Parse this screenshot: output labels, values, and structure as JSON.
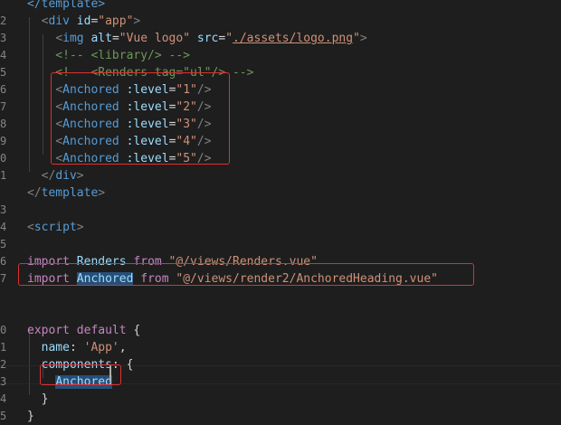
{
  "editor": {
    "gutter": [
      "",
      "2",
      "3",
      "4",
      "5",
      "6",
      "7",
      "8",
      "9",
      "0",
      "1",
      "",
      "3",
      "4",
      "5",
      "6",
      "7",
      "",
      "",
      "0",
      "1",
      "2",
      "3",
      "4",
      "5"
    ],
    "lines": [
      [
        {
          "t": "</template>",
          "c": "tk-tag"
        }
      ],
      [
        {
          "t": "  ",
          "c": "tk-plain"
        },
        {
          "t": "<",
          "c": "tk-bracket"
        },
        {
          "t": "div",
          "c": "tk-tag"
        },
        {
          "t": " id",
          "c": "tk-attr"
        },
        {
          "t": "=",
          "c": "tk-plain"
        },
        {
          "t": "\"app\"",
          "c": "tk-str"
        },
        {
          "t": ">",
          "c": "tk-bracket"
        }
      ],
      [
        {
          "t": "    ",
          "c": "tk-plain"
        },
        {
          "t": "<",
          "c": "tk-bracket"
        },
        {
          "t": "img",
          "c": "tk-tag"
        },
        {
          "t": " alt",
          "c": "tk-attr"
        },
        {
          "t": "=",
          "c": "tk-plain"
        },
        {
          "t": "\"Vue logo\"",
          "c": "tk-str"
        },
        {
          "t": " src",
          "c": "tk-attr"
        },
        {
          "t": "=",
          "c": "tk-plain"
        },
        {
          "t": "\"",
          "c": "tk-str"
        },
        {
          "t": "./assets/logo.png",
          "c": "tk-str tk-link"
        },
        {
          "t": "\"",
          "c": "tk-str"
        },
        {
          "t": ">",
          "c": "tk-bracket"
        }
      ],
      [
        {
          "t": "    <!-- <library/> -->",
          "c": "tk-comment"
        }
      ],
      [
        {
          "t": "    <!-- <Renders tag=\"ul\"/> -->",
          "c": "tk-comment"
        }
      ],
      [
        {
          "t": "    ",
          "c": "tk-plain"
        },
        {
          "t": "<",
          "c": "tk-bracket"
        },
        {
          "t": "Anchored",
          "c": "tk-tag"
        },
        {
          "t": " :level",
          "c": "tk-attr"
        },
        {
          "t": "=",
          "c": "tk-plain"
        },
        {
          "t": "\"1\"",
          "c": "tk-str"
        },
        {
          "t": "/>",
          "c": "tk-bracket"
        }
      ],
      [
        {
          "t": "    ",
          "c": "tk-plain"
        },
        {
          "t": "<",
          "c": "tk-bracket"
        },
        {
          "t": "Anchored",
          "c": "tk-tag"
        },
        {
          "t": " :level",
          "c": "tk-attr"
        },
        {
          "t": "=",
          "c": "tk-plain"
        },
        {
          "t": "\"2\"",
          "c": "tk-str"
        },
        {
          "t": "/>",
          "c": "tk-bracket"
        }
      ],
      [
        {
          "t": "    ",
          "c": "tk-plain"
        },
        {
          "t": "<",
          "c": "tk-bracket"
        },
        {
          "t": "Anchored",
          "c": "tk-tag"
        },
        {
          "t": " :level",
          "c": "tk-attr"
        },
        {
          "t": "=",
          "c": "tk-plain"
        },
        {
          "t": "\"3\"",
          "c": "tk-str"
        },
        {
          "t": "/>",
          "c": "tk-bracket"
        }
      ],
      [
        {
          "t": "    ",
          "c": "tk-plain"
        },
        {
          "t": "<",
          "c": "tk-bracket"
        },
        {
          "t": "Anchored",
          "c": "tk-tag"
        },
        {
          "t": " :level",
          "c": "tk-attr"
        },
        {
          "t": "=",
          "c": "tk-plain"
        },
        {
          "t": "\"4\"",
          "c": "tk-str"
        },
        {
          "t": "/>",
          "c": "tk-bracket"
        }
      ],
      [
        {
          "t": "    ",
          "c": "tk-plain"
        },
        {
          "t": "<",
          "c": "tk-bracket"
        },
        {
          "t": "Anchored",
          "c": "tk-tag"
        },
        {
          "t": " :level",
          "c": "tk-attr"
        },
        {
          "t": "=",
          "c": "tk-plain"
        },
        {
          "t": "\"5\"",
          "c": "tk-str"
        },
        {
          "t": "/>",
          "c": "tk-bracket"
        }
      ],
      [
        {
          "t": "  ",
          "c": "tk-plain"
        },
        {
          "t": "</",
          "c": "tk-bracket"
        },
        {
          "t": "div",
          "c": "tk-tag"
        },
        {
          "t": ">",
          "c": "tk-bracket"
        }
      ],
      [
        {
          "t": "</",
          "c": "tk-bracket"
        },
        {
          "t": "template",
          "c": "tk-tag"
        },
        {
          "t": ">",
          "c": "tk-bracket"
        }
      ],
      [],
      [
        {
          "t": "<",
          "c": "tk-bracket"
        },
        {
          "t": "script",
          "c": "tk-tag"
        },
        {
          "t": ">",
          "c": "tk-bracket"
        }
      ],
      [],
      [
        {
          "t": "import",
          "c": "tk-kw"
        },
        {
          "t": " Renders ",
          "c": "tk-ident"
        },
        {
          "t": "from",
          "c": "tk-kw"
        },
        {
          "t": " \"@/views/Renders.vue\"",
          "c": "tk-str"
        }
      ],
      [
        {
          "t": "import",
          "c": "tk-kw"
        },
        {
          "t": " ",
          "c": "tk-plain"
        },
        {
          "t": "Anchored",
          "c": "tk-ident hl-word"
        },
        {
          "t": " ",
          "c": "tk-plain"
        },
        {
          "t": "from",
          "c": "tk-kw"
        },
        {
          "t": " \"@/views/render2/AnchoredHeading.vue\"",
          "c": "tk-str"
        }
      ],
      [],
      [],
      [
        {
          "t": "export",
          "c": "tk-kw"
        },
        {
          "t": " ",
          "c": "tk-plain"
        },
        {
          "t": "default",
          "c": "tk-kw"
        },
        {
          "t": " {",
          "c": "tk-plain"
        }
      ],
      [
        {
          "t": "  name",
          "c": "tk-ident"
        },
        {
          "t": ": ",
          "c": "tk-plain"
        },
        {
          "t": "'App'",
          "c": "tk-str"
        },
        {
          "t": ",",
          "c": "tk-plain"
        }
      ],
      [
        {
          "t": "  components",
          "c": "tk-ident"
        },
        {
          "t": ": {",
          "c": "tk-plain"
        }
      ],
      [
        {
          "t": "    ",
          "c": "tk-plain"
        },
        {
          "t": "Anchored",
          "c": "tk-ident hl-word"
        }
      ],
      [
        {
          "t": "  }",
          "c": "tk-plain"
        }
      ],
      [
        {
          "t": "}",
          "c": "tk-plain"
        }
      ]
    ]
  },
  "colors": {
    "background": "#1e1e1e",
    "highlight_box": "#e03030",
    "selection": "#264f78"
  }
}
